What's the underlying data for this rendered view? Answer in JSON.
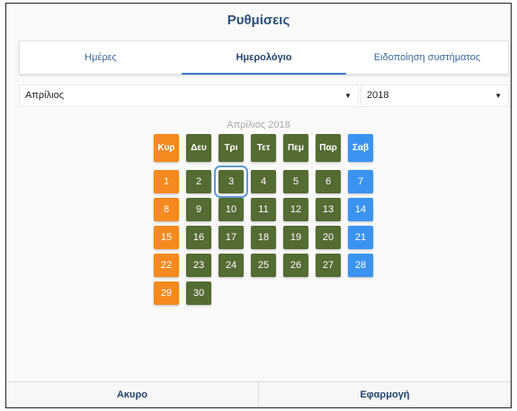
{
  "header": {
    "title": "Ρυθμίσεις"
  },
  "tabs": [
    {
      "label": "Ημέρες",
      "active": false
    },
    {
      "label": "Ημερολόγιο",
      "active": true
    },
    {
      "label": "Ειδοποίηση συστήματος",
      "active": false
    }
  ],
  "selects": {
    "month": {
      "value": "Απρίλιος",
      "arrow": "▼"
    },
    "year": {
      "value": "2018",
      "arrow": "▼"
    }
  },
  "calendar": {
    "title": "Απρίλιος 2018",
    "weekdays": [
      "Κυρ",
      "Δευ",
      "Τρι",
      "Τετ",
      "Πεμ",
      "Παρ",
      "Σαβ"
    ],
    "weeks": [
      [
        "1",
        "2",
        "3",
        "4",
        "5",
        "6",
        "7"
      ],
      [
        "8",
        "9",
        "10",
        "11",
        "12",
        "13",
        "14"
      ],
      [
        "15",
        "16",
        "17",
        "18",
        "19",
        "20",
        "21"
      ],
      [
        "22",
        "23",
        "24",
        "25",
        "26",
        "27",
        "28"
      ],
      [
        "29",
        "30",
        "",
        "",
        "",
        "",
        ""
      ]
    ],
    "selected_day": "3",
    "colors": {
      "sunday": "#f58a1f",
      "weekday": "#546b32",
      "saturday": "#3b93f0",
      "selected_outline": "#5b9bd6"
    }
  },
  "footer": {
    "cancel_label": "Ακυρο",
    "apply_label": "Εφαρμογή"
  }
}
